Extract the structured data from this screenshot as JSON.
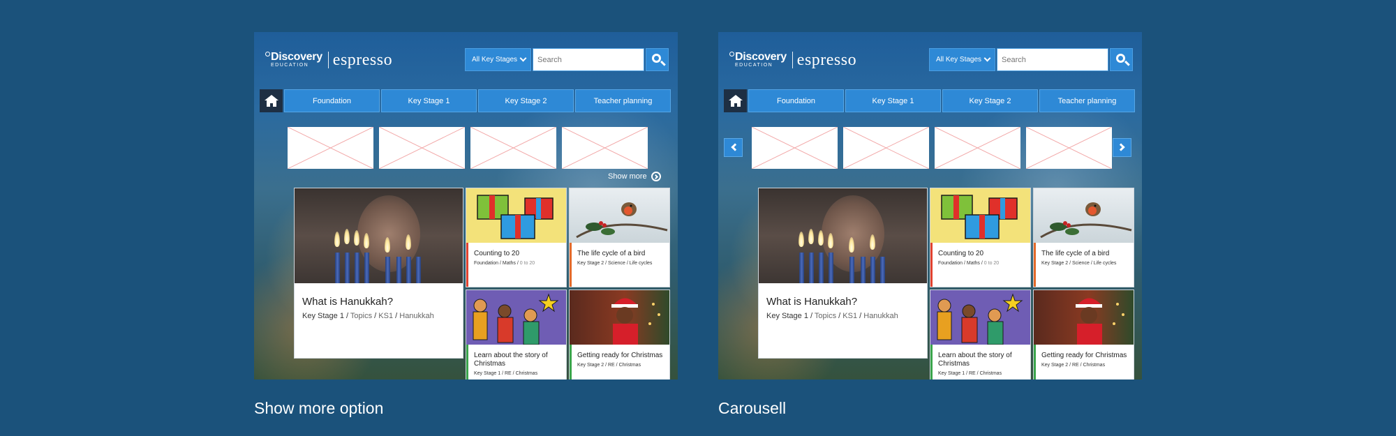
{
  "logo": {
    "brand": "Discovery",
    "sub": "EDUCATION",
    "product": "espresso"
  },
  "search": {
    "stage_label": "All Key Stages",
    "placeholder": "Search"
  },
  "nav": {
    "items": [
      "Foundation",
      "Key Stage 1",
      "Key Stage 2",
      "Teacher planning"
    ]
  },
  "show_more": {
    "label": "Show more"
  },
  "feature": {
    "title": "What is Hanukkah?",
    "crumbs": [
      "Key Stage 1",
      "Topics",
      "KS1",
      "Hanukkah"
    ]
  },
  "cards": [
    {
      "title": "Counting to 20",
      "crumbs": [
        "Foundation",
        "Maths",
        "0 to 20"
      ],
      "accent": "#e2422f"
    },
    {
      "title": "The life cycle of a bird",
      "crumbs": [
        "Key Stage 2",
        "Science",
        "Life cycles"
      ],
      "accent": "#e46a2a"
    },
    {
      "title": "Learn about the story of Christmas",
      "crumbs": [
        "Key Stage 1",
        "RE",
        "Christmas"
      ],
      "accent": "#3aa54b"
    },
    {
      "title": "Getting ready for Christmas",
      "crumbs": [
        "Key Stage 2",
        "RE",
        "Christmas"
      ],
      "accent": "#3aa54b"
    }
  ],
  "captions": {
    "left": "Show more option",
    "right": "Carousell"
  },
  "colors": {
    "background": "#1b527b",
    "nav_blue": "#2e89d6",
    "home_dark": "#1e2f43"
  },
  "icons": {
    "home": "home-icon",
    "search": "search-icon",
    "chevron": "chevron-down-icon",
    "carousel_prev": "chevron-left-icon",
    "carousel_next": "chevron-right-icon",
    "show_more": "circle-chevron-right-icon"
  }
}
